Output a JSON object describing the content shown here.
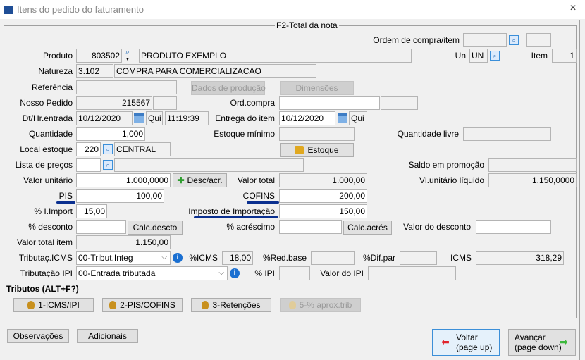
{
  "window": {
    "title": "Itens do pedido do faturamento",
    "close": "×"
  },
  "group_title": "F2-Total da nota",
  "labels": {
    "ordem": "Ordem de compra/item",
    "produto": "Produto",
    "un": "Un",
    "item": "Item",
    "natureza": "Natureza",
    "referencia": "Referência",
    "nosso_pedido": "Nosso Pedido",
    "ord_compra": "Ord.compra",
    "dt_entrada": "Dt/Hr.entrada",
    "entrega": "Entrega do item",
    "quantidade": "Quantidade",
    "estoque_minimo": "Estoque mínimo",
    "quantidade_livre": "Quantidade livre",
    "local_estoque": "Local estoque",
    "lista_precos": "Lista de preços",
    "saldo_promocao": "Saldo em promoção",
    "valor_unitario": "Valor unitário",
    "valor_total": "Valor total",
    "vl_unit_liquido": "Vl.unitário líquido",
    "pis": "PIS",
    "cofins": "COFINS",
    "i_import": "% I.Import",
    "imposto_importacao": "Imposto de Importação",
    "desconto": "% desconto",
    "acrescimo": "% acréscimo",
    "valor_desconto": "Valor do desconto",
    "valor_total_item": "Valor total item",
    "trib_icms": "Tributaç.ICMS",
    "p_icms": "%ICMS",
    "red_base": "%Red.base",
    "dif_par": "%Dif.par",
    "icms": "ICMS",
    "trib_ipi": "Tributação IPI",
    "p_ipi": "% IPI",
    "valor_ipi": "Valor do IPI",
    "tributos": "Tributos (ALT+F?)"
  },
  "values": {
    "produto_cod": "803502",
    "produto_desc": "PRODUTO EXEMPLO",
    "un": "UN",
    "item": "1",
    "natureza_cod": "3.102",
    "natureza_desc": "COMPRA PARA COMERCIALIZACAO",
    "nosso_pedido": "215567",
    "dt_entrada": "10/12/2020",
    "dia_entrada": "Qui",
    "hr_entrada": "11:19:39",
    "entrega": "10/12/2020",
    "dia_entrega": "Qui",
    "quantidade": "1,000",
    "local_cod": "220",
    "local_desc": "CENTRAL",
    "valor_unitario": "1.000,0000",
    "valor_total": "1.000,00",
    "vl_unit_liquido": "1.150,0000",
    "pis": "100,00",
    "cofins": "200,00",
    "i_import": "15,00",
    "imposto_importacao": "150,00",
    "valor_total_item": "1.150,00",
    "trib_icms": "00-Tribut.Integ",
    "p_icms": "18,00",
    "icms": "318,29",
    "trib_ipi": "00-Entrada tributada"
  },
  "buttons": {
    "dados_producao": "Dados de produção",
    "dimensoes": "Dimensões",
    "estoque": "Estoque",
    "desc_acr": "Desc/acr.",
    "calc_desc": "Calc.descto",
    "calc_acres": "Calc.acrés",
    "icms_ipi": "1-ICMS/IPI",
    "pis_cofins": "2-PIS/COFINS",
    "retencoes": "3-Retenções",
    "aprox_trib": "5-% aprox.trib",
    "observacoes": "Observações",
    "adicionais": "Adicionais",
    "voltar": "Voltar",
    "voltar_sub": "(page up)",
    "avancar": "Avançar",
    "avancar_sub": "(page down)"
  },
  "colors": {
    "underline": "#0a2f8f",
    "focus_border": "#3c8fd8"
  }
}
